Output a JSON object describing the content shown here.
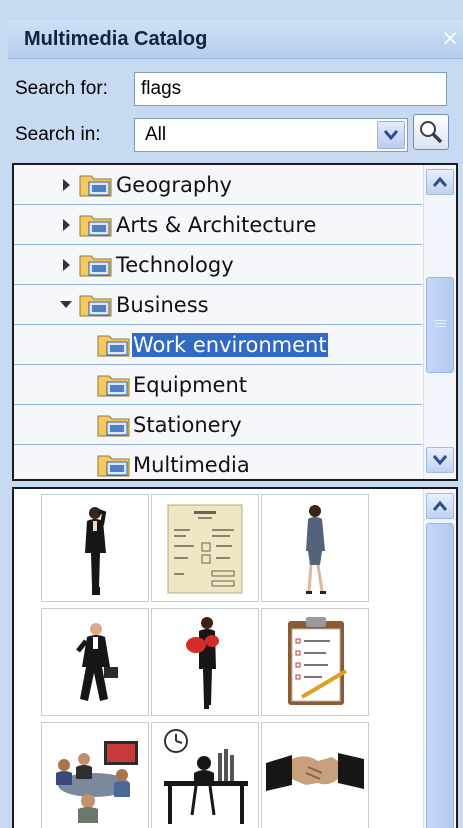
{
  "panel": {
    "title": "Multimedia Catalog",
    "close_glyph": "×"
  },
  "search": {
    "search_for_label": "Search for:",
    "query": "flags",
    "search_in_label": "Search in:",
    "scope_selected": "All"
  },
  "tree": {
    "items": [
      {
        "label": "Geography",
        "state": "collapsed",
        "level": 1
      },
      {
        "label": "Arts & Architecture",
        "state": "collapsed",
        "level": 1
      },
      {
        "label": "Technology",
        "state": "collapsed",
        "level": 1
      },
      {
        "label": "Business",
        "state": "expanded",
        "level": 1
      },
      {
        "label": "Work environment",
        "state": "leaf",
        "level": 2,
        "selected": true
      },
      {
        "label": "Equipment",
        "state": "leaf",
        "level": 2
      },
      {
        "label": "Stationery",
        "state": "leaf",
        "level": 2
      },
      {
        "label": "Multimedia",
        "state": "leaf",
        "level": 2
      }
    ]
  },
  "clipart": {
    "items": [
      "businesswoman-on-phone",
      "invoice-document",
      "businesswoman-walking",
      "businessman-with-briefcase",
      "businesswoman-carrying-files",
      "clipboard-with-pen",
      "video-conference-meeting",
      "worker-at-desk-with-clock",
      "handshake"
    ]
  },
  "colors": {
    "accent": "#316ac5",
    "panel_background": "#c8daf2",
    "folder": "#f6c95a"
  }
}
